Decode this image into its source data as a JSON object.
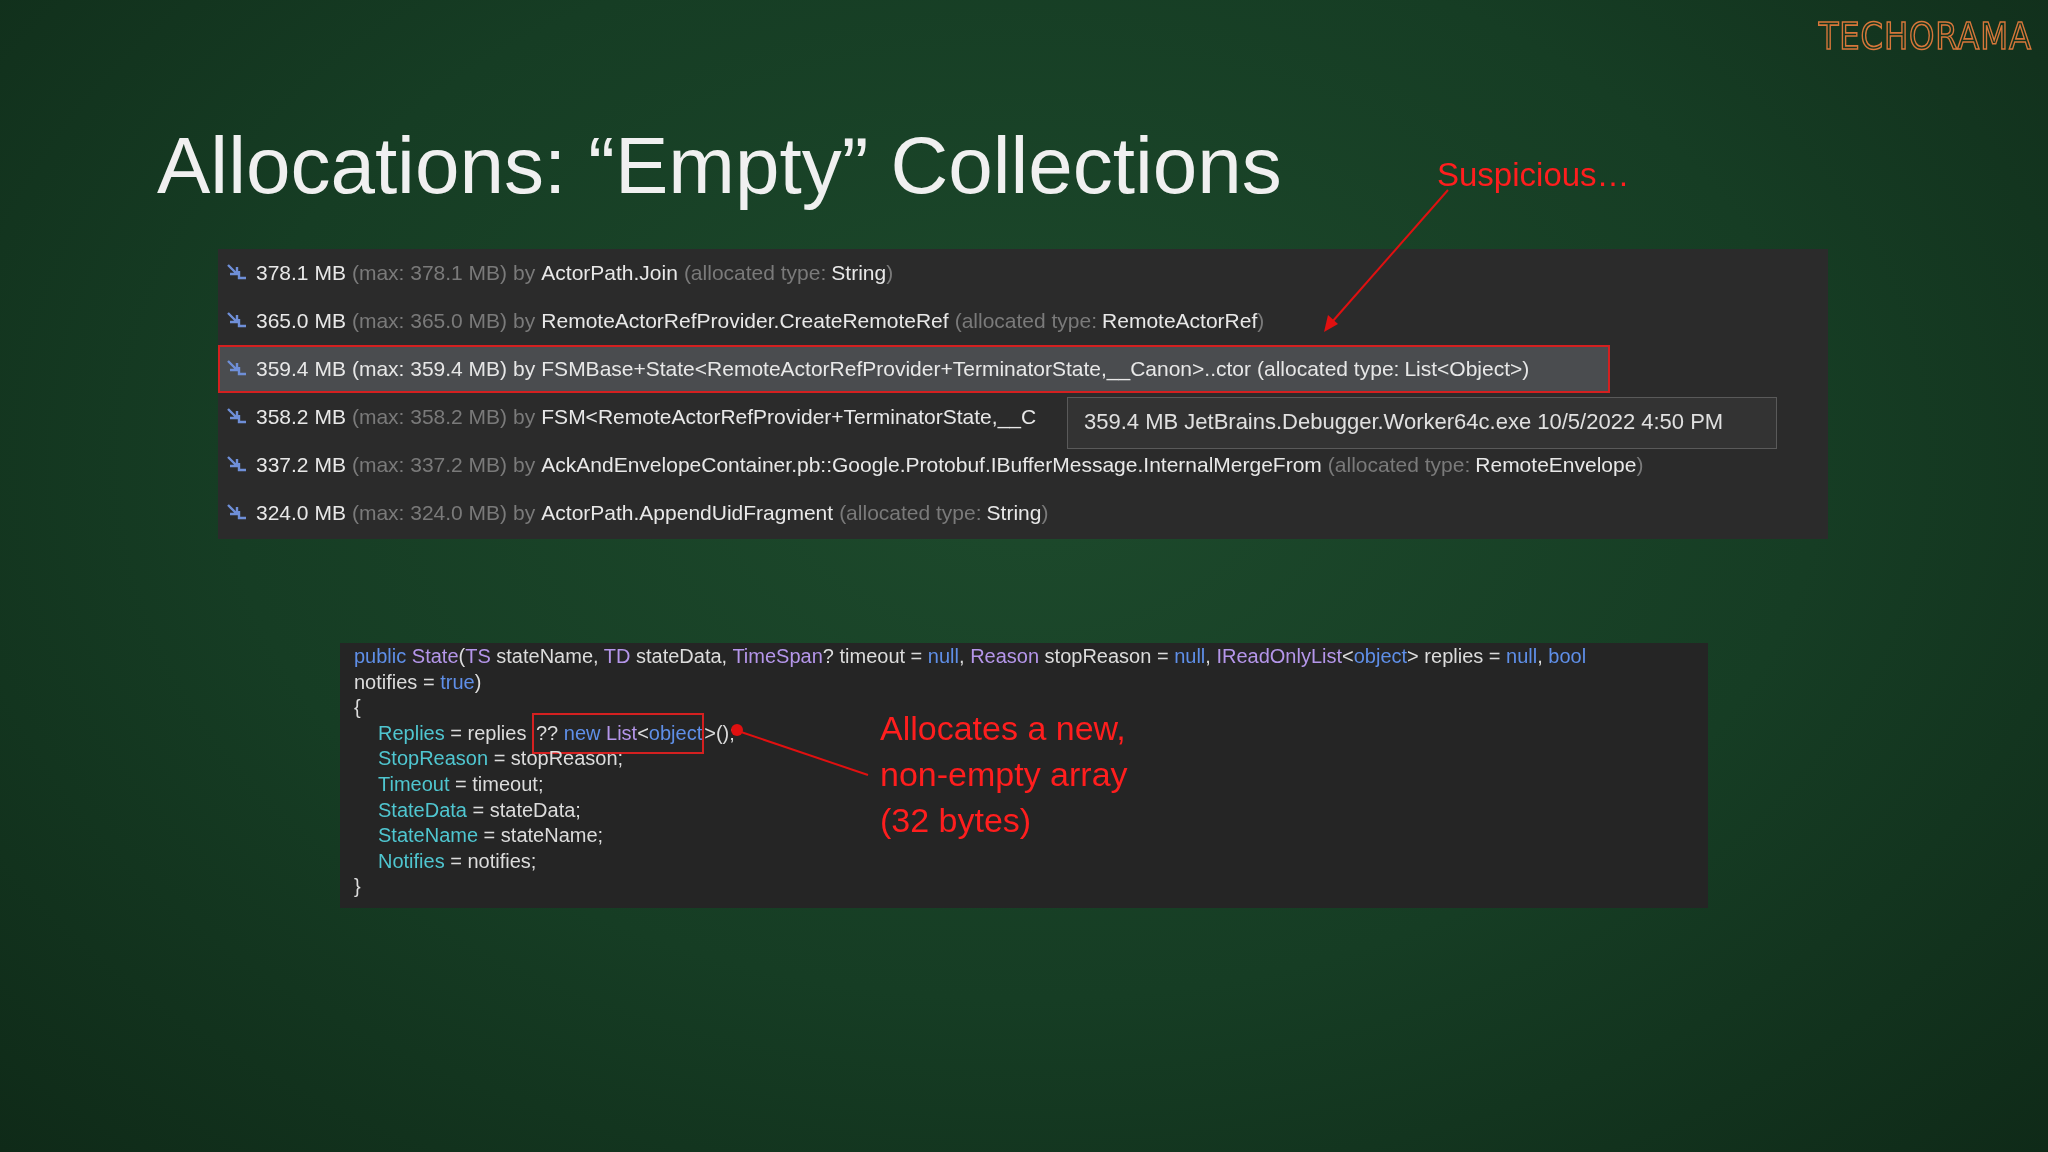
{
  "logo": "TECHORAMA",
  "title": "Allocations: “Empty” Collections",
  "callout": "Suspicious…",
  "allocations": [
    {
      "size": "378.1 MB",
      "max": "(max: 378.1 MB)",
      "by": "by",
      "method": "ActorPath.Join",
      "type_open": "(allocated type:",
      "type": "String",
      "type_close": ")",
      "selected": false
    },
    {
      "size": "365.0 MB",
      "max": "(max: 365.0 MB)",
      "by": "by",
      "method": "RemoteActorRefProvider.CreateRemoteRef",
      "type_open": "(allocated type:",
      "type": "RemoteActorRef",
      "type_close": ")",
      "selected": false
    },
    {
      "size": "359.4 MB",
      "max": "(max: 359.4 MB)",
      "by": "by",
      "method": "FSMBase+State<RemoteActorRefProvider+TerminatorState,__Canon>..ctor",
      "type_open": "(allocated type:",
      "type": "List<Object>",
      "type_close": ")",
      "selected": true
    },
    {
      "size": "358.2 MB",
      "max": "(max: 358.2 MB)",
      "by": "by",
      "method": "FSM<RemoteActorRefProvider+TerminatorState,__C",
      "selected": false
    },
    {
      "size": "337.2 MB",
      "max": "(max: 337.2 MB)",
      "by": "by",
      "method": "AckAndEnvelopeContainer.pb::Google.Protobuf.IBufferMessage.InternalMergeFrom",
      "type_open": "(allocated type:",
      "type": "RemoteEnvelope",
      "type_close": ")",
      "selected": false
    },
    {
      "size": "324.0 MB",
      "max": "(max: 324.0 MB)",
      "by": "by",
      "method": "ActorPath.AppendUidFragment",
      "type_open": "(allocated type:",
      "type": "String",
      "type_close": ")",
      "selected": false
    }
  ],
  "tooltip": "359.4 MB JetBrains.Debugger.Worker64c.exe 10/5/2022 4:50 PM",
  "code": [
    {
      "indented": false,
      "tokens": [
        {
          "kind": "keyword",
          "text": "public "
        },
        {
          "kind": "type",
          "text": "State"
        },
        {
          "kind": "plain",
          "text": "("
        },
        {
          "kind": "type",
          "text": "TS"
        },
        {
          "kind": "plain",
          "text": " stateName, "
        },
        {
          "kind": "type",
          "text": "TD"
        },
        {
          "kind": "plain",
          "text": " stateData, "
        },
        {
          "kind": "type",
          "text": "TimeSpan"
        },
        {
          "kind": "plain",
          "text": "? timeout = "
        },
        {
          "kind": "keyword",
          "text": "null"
        },
        {
          "kind": "plain",
          "text": ", "
        },
        {
          "kind": "type",
          "text": "Reason"
        },
        {
          "kind": "plain",
          "text": " stopReason = "
        },
        {
          "kind": "keyword",
          "text": "null"
        },
        {
          "kind": "plain",
          "text": ", "
        },
        {
          "kind": "type",
          "text": "IReadOnlyList"
        },
        {
          "kind": "plain",
          "text": "<"
        },
        {
          "kind": "keyword",
          "text": "object"
        },
        {
          "kind": "plain",
          "text": "> replies = "
        },
        {
          "kind": "keyword",
          "text": "null"
        },
        {
          "kind": "plain",
          "text": ", "
        },
        {
          "kind": "keyword",
          "text": "bool"
        }
      ]
    },
    {
      "indented": false,
      "tokens": [
        {
          "kind": "plain",
          "text": "notifies = "
        },
        {
          "kind": "keyword",
          "text": "true"
        },
        {
          "kind": "plain",
          "text": ")"
        }
      ]
    },
    {
      "indented": false,
      "tokens": [
        {
          "kind": "plain",
          "text": "{"
        }
      ]
    },
    {
      "indented": true,
      "tokens": [
        {
          "kind": "property",
          "text": "Replies"
        },
        {
          "kind": "plain",
          "text": " = replies "
        },
        {
          "kind": "box",
          "tokens": [
            {
              "kind": "plain",
              "text": "?? "
            },
            {
              "kind": "keyword",
              "text": "new "
            },
            {
              "kind": "type",
              "text": "List"
            },
            {
              "kind": "plain",
              "text": "<"
            },
            {
              "kind": "keyword",
              "text": "object"
            }
          ]
        },
        {
          "kind": "plain",
          "text": ">();"
        }
      ]
    },
    {
      "indented": true,
      "tokens": [
        {
          "kind": "property",
          "text": "StopReason"
        },
        {
          "kind": "plain",
          "text": " = stopReason;"
        }
      ]
    },
    {
      "indented": true,
      "tokens": [
        {
          "kind": "property",
          "text": "Timeout"
        },
        {
          "kind": "plain",
          "text": " = timeout;"
        }
      ]
    },
    {
      "indented": true,
      "tokens": [
        {
          "kind": "property",
          "text": "StateData"
        },
        {
          "kind": "plain",
          "text": " = stateData;"
        }
      ]
    },
    {
      "indented": true,
      "tokens": [
        {
          "kind": "property",
          "text": "StateName"
        },
        {
          "kind": "plain",
          "text": " = stateName;"
        }
      ]
    },
    {
      "indented": true,
      "tokens": [
        {
          "kind": "property",
          "text": "Notifies"
        },
        {
          "kind": "plain",
          "text": " = notifies;"
        }
      ]
    },
    {
      "indented": false,
      "tokens": [
        {
          "kind": "plain",
          "text": "}"
        }
      ]
    }
  ],
  "note": [
    "Allocates a new,",
    "non-empty array",
    "(32 bytes)"
  ]
}
